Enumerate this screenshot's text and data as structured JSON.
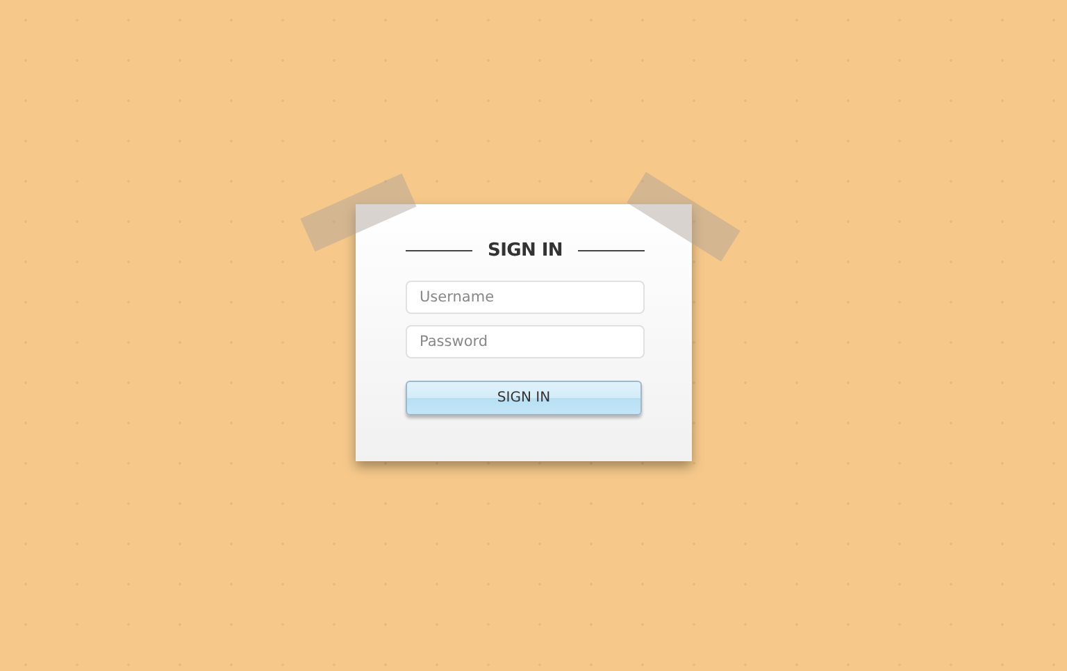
{
  "title": "SIGN IN",
  "fields": [
    {
      "placeholder": "Username"
    },
    {
      "placeholder": "Password"
    }
  ],
  "button": "SIGN IN"
}
